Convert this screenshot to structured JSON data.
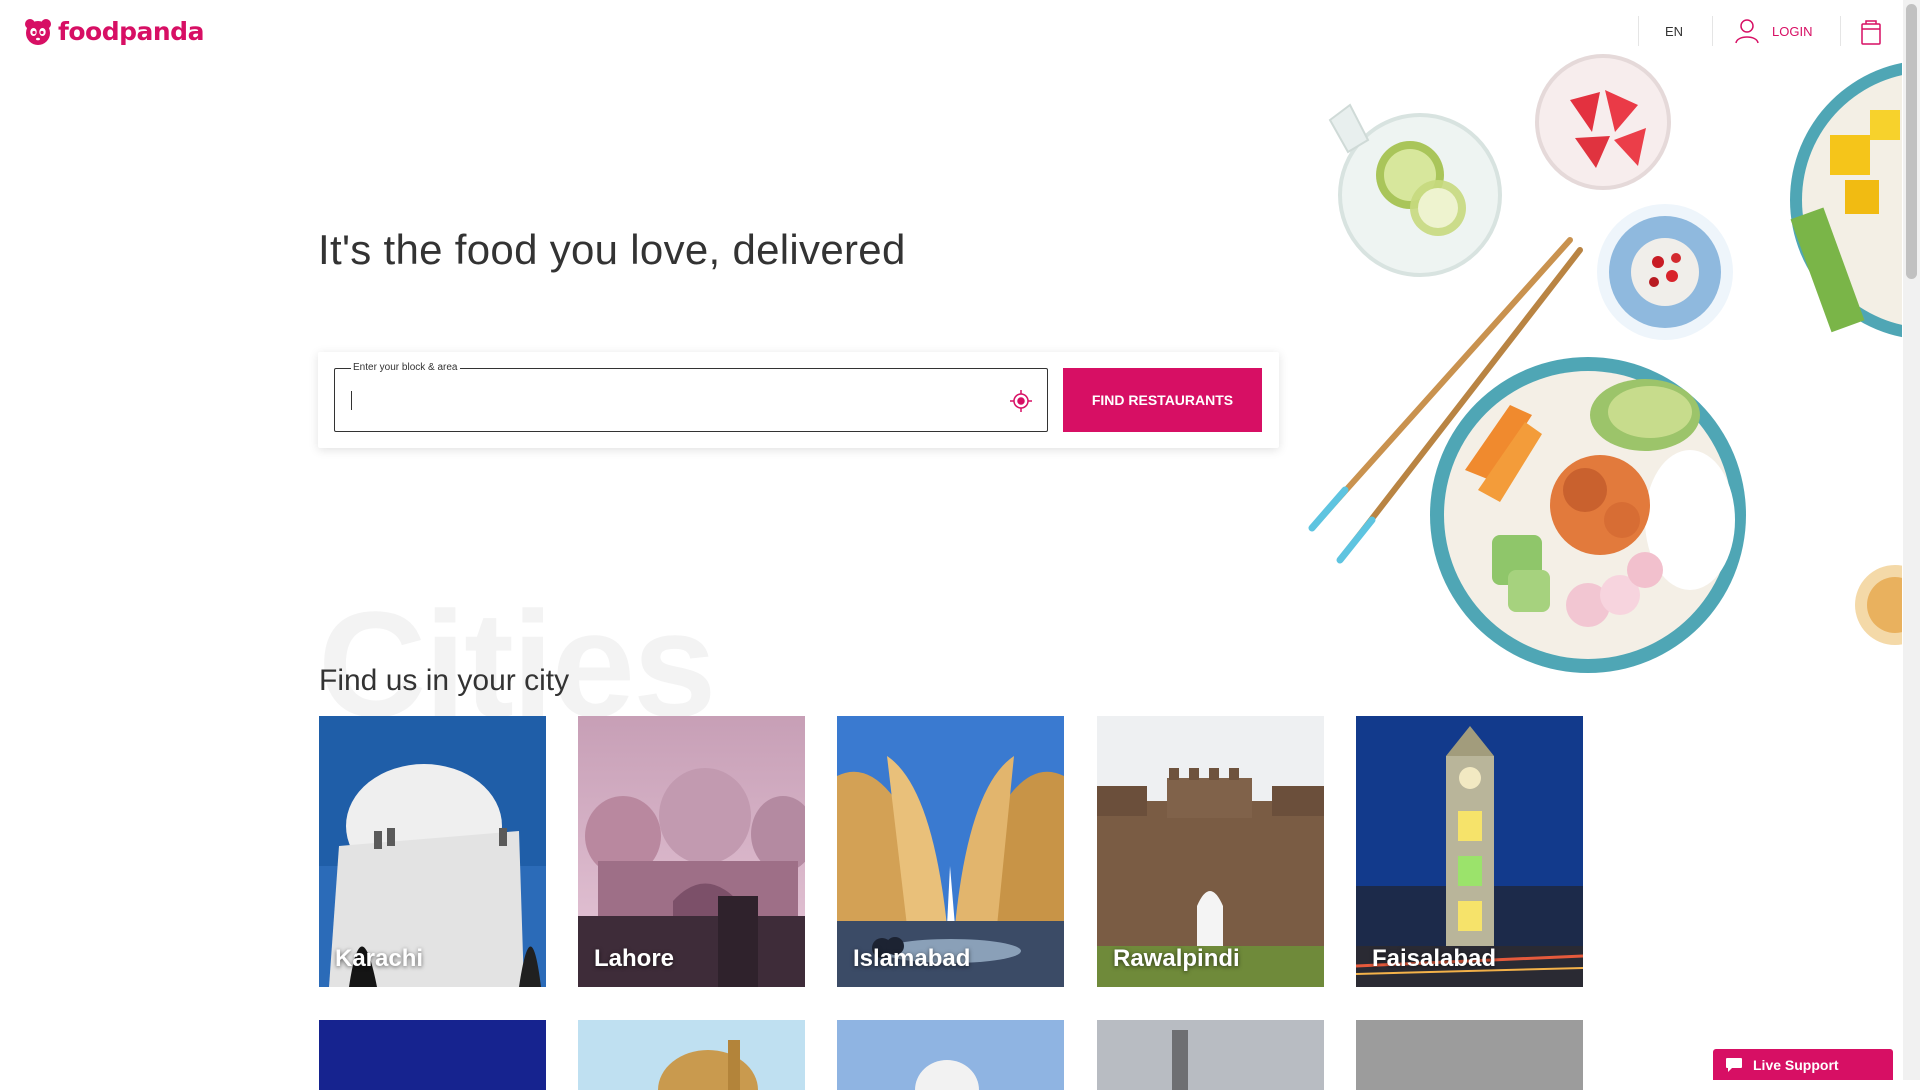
{
  "brand": {
    "name": "foodpanda",
    "color": "#d70f64"
  },
  "header": {
    "language": "EN",
    "login_label": "LOGIN",
    "cart_icon": "shopping-bag-icon"
  },
  "hero": {
    "title": "It's the food you love, delivered",
    "search": {
      "label": "Enter your block & area",
      "placeholder": "",
      "value": "",
      "locate_icon": "locate-me-icon"
    },
    "button_label": "FIND RESTAURANTS"
  },
  "cities": {
    "background_word": "Cities",
    "title": "Find us in your city",
    "items": [
      {
        "name": "Karachi"
      },
      {
        "name": "Lahore"
      },
      {
        "name": "Islamabad"
      },
      {
        "name": "Rawalpindi"
      },
      {
        "name": "Faisalabad"
      }
    ]
  },
  "live_support": {
    "label": "Live Support",
    "icon": "chat-bubble-icon"
  }
}
